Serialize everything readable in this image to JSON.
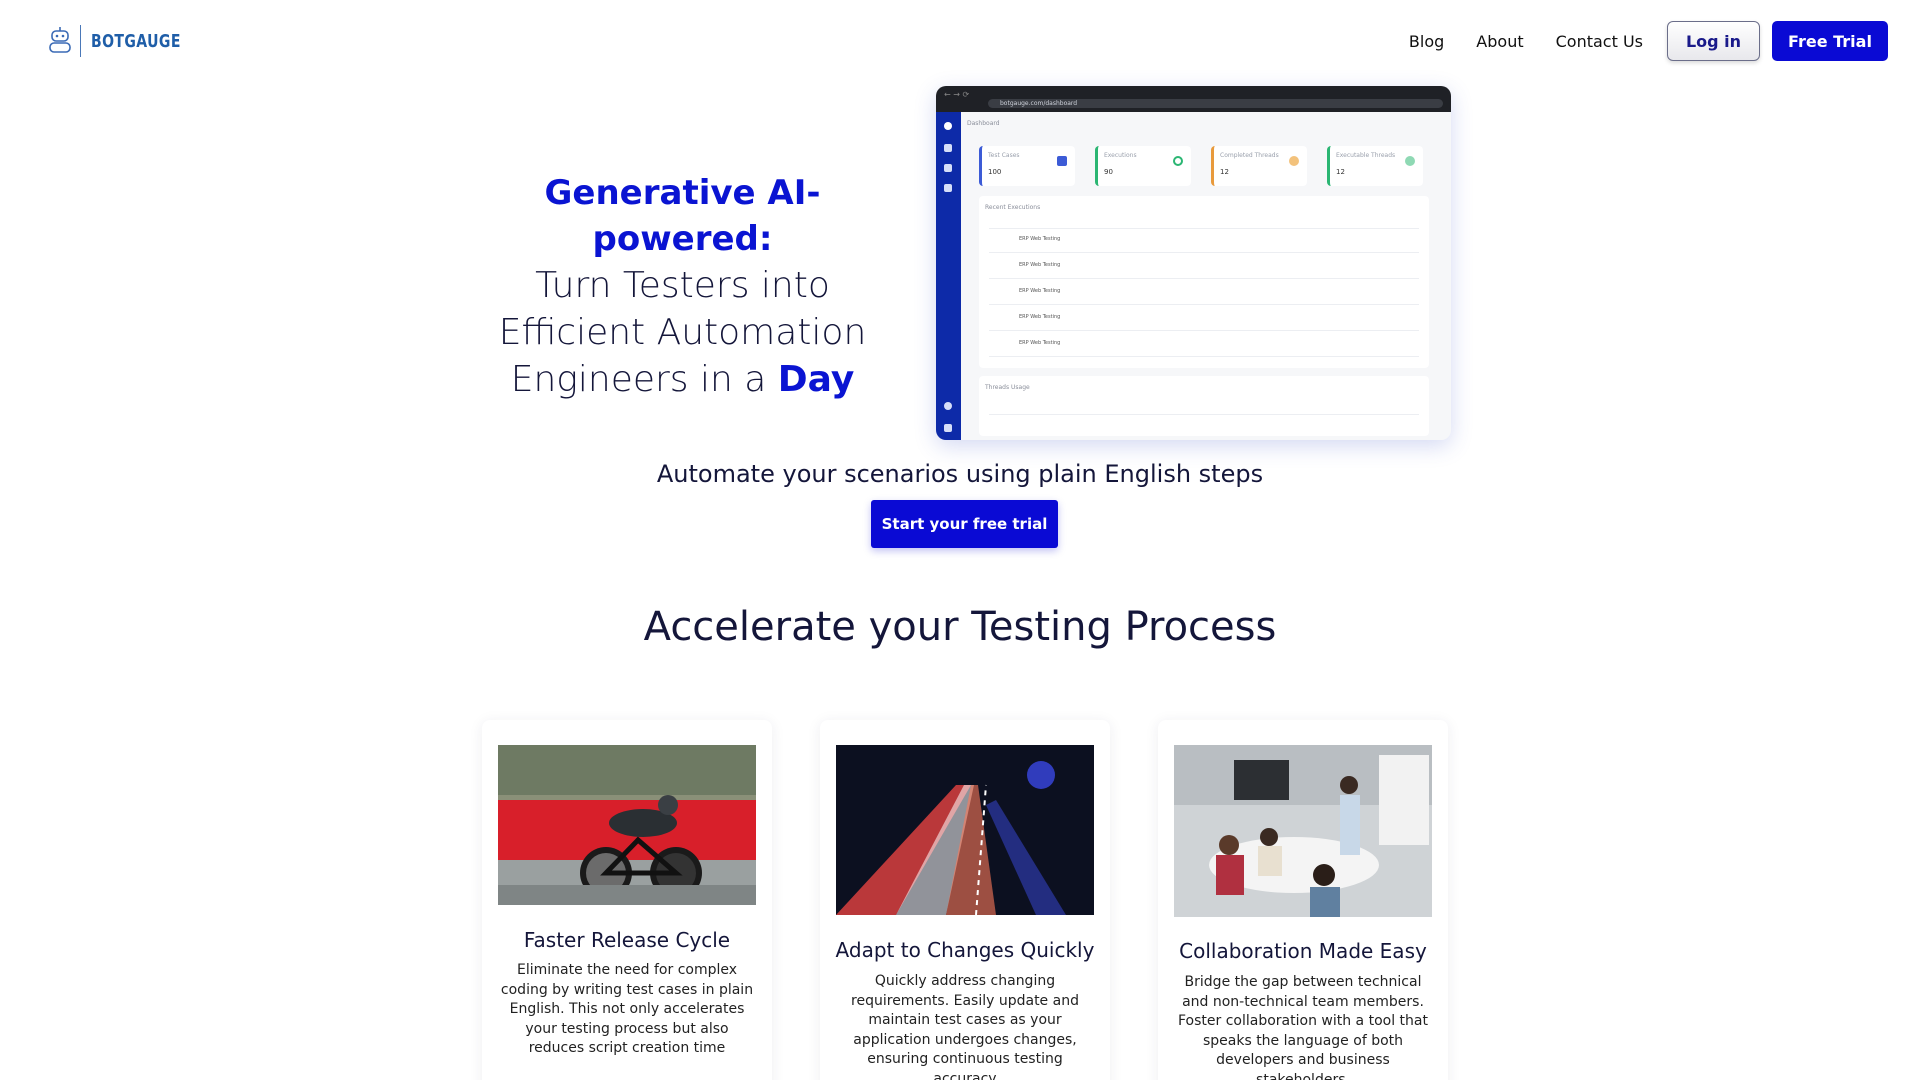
{
  "brand": {
    "name": "BOTGAUGE",
    "logo_icon": "robot-icon"
  },
  "nav": {
    "links": [
      "Blog",
      "About",
      "Contact Us"
    ],
    "login_label": "Log in",
    "trial_label": "Free Trial"
  },
  "hero": {
    "accent": "Generative AI-powered:",
    "line1": "Turn Testers into",
    "line2": "Efficient Automation",
    "line3_prefix": "Engineers in a ",
    "line3_accent": "Day"
  },
  "dashboard": {
    "url": "botgauge.com/dashboard",
    "crumb": "Dashboard",
    "stats": [
      {
        "label": "Test Cases",
        "value": "100",
        "color": "#3c5bd6"
      },
      {
        "label": "Executions",
        "value": "90",
        "color": "#2bb673"
      },
      {
        "label": "Completed Threads",
        "value": "12",
        "color": "#e89a3c"
      },
      {
        "label": "Executable Threads",
        "value": "12",
        "color": "#2bb673"
      }
    ],
    "recent_title": "Recent Executions",
    "rows": [
      "ERP Web Testing",
      "ERP Web Testing",
      "ERP Web Testing",
      "ERP Web Testing",
      "ERP Web Testing"
    ],
    "threads_title": "Threads Usage"
  },
  "subhead": "Automate your scenarios using plain English steps",
  "cta_label": "Start your free trial",
  "section_title": "Accelerate your Testing Process",
  "cards": [
    {
      "title": "Faster Release Cycle",
      "text": "Eliminate the need for complex coding by writing test cases in plain English. This not only accelerates your testing process but also reduces script creation time"
    },
    {
      "title": "Adapt to Changes Quickly",
      "text": "Quickly address changing requirements.  Easily update and maintain test cases as your application undergoes changes, ensuring continuous testing accuracy"
    },
    {
      "title": "Collaboration Made Easy",
      "text": "Bridge the gap between technical and non-technical team members. Foster collaboration with a tool that speaks the language of both developers and business stakeholders."
    }
  ],
  "colors": {
    "accent": "#0a0ad4",
    "text": "#14163a"
  }
}
